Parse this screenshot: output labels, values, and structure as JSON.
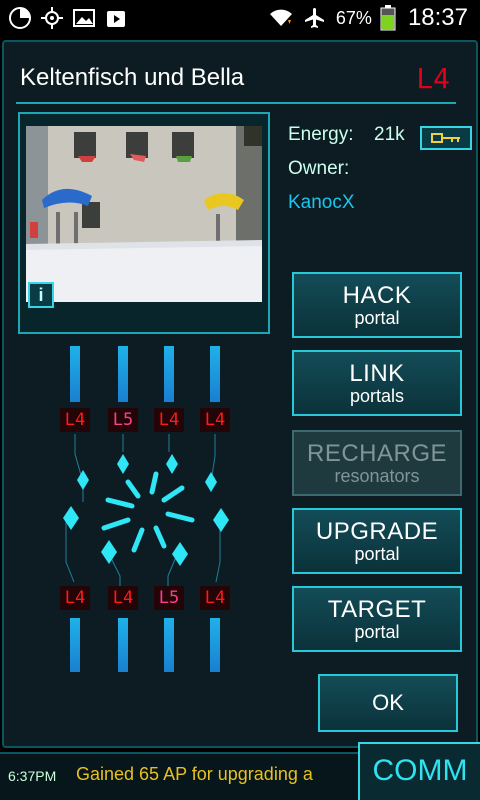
{
  "status_bar": {
    "battery_percent": "67%",
    "time": "18:37",
    "icons": [
      "pie-chart-icon",
      "gps-icon",
      "image-icon",
      "play-store-icon",
      "wifi-icon",
      "airplane-mode-icon",
      "battery-icon"
    ]
  },
  "portal": {
    "name": "Keltenfisch und Bella",
    "level": "L4",
    "energy_label": "Energy:",
    "energy_value": "21k",
    "owner_label": "Owner:",
    "owner_name": "KanocX",
    "info_label": "i"
  },
  "actions": [
    {
      "label": "HACK",
      "sub": "portal",
      "enabled": true
    },
    {
      "label": "LINK",
      "sub": "portals",
      "enabled": true
    },
    {
      "label": "RECHARGE",
      "sub": "resonators",
      "enabled": false
    },
    {
      "label": "UPGRADE",
      "sub": "portal",
      "enabled": true
    },
    {
      "label": "TARGET",
      "sub": "portal",
      "enabled": true
    }
  ],
  "ok_label": "OK",
  "resonators": {
    "top": [
      "L4",
      "L5",
      "L4",
      "L4"
    ],
    "bottom": [
      "L4",
      "L4",
      "L5",
      "L4"
    ]
  },
  "comm": {
    "time": "6:37PM",
    "message": "Gained 65 AP for upgrading a",
    "button_label": "COMM"
  },
  "colors": {
    "accent": "#1aa8b4",
    "level_red": "#e0001a",
    "level_pink": "#ff3d8c",
    "owner_blue": "#18c6f0",
    "comm_message": "#e8c020"
  }
}
